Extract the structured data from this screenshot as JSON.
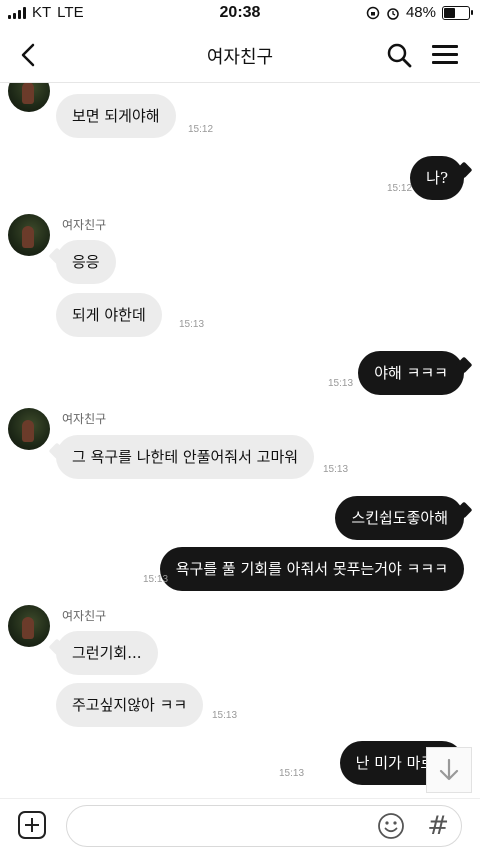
{
  "status_bar": {
    "carrier": "KT",
    "network": "LTE",
    "time": "20:38",
    "battery": "48%",
    "battery_level": 0.48
  },
  "header": {
    "title": "여자친구"
  },
  "messages": [
    {
      "text": "보면 되게야해",
      "time": "15:12",
      "direction": "in"
    },
    {
      "text": "나?",
      "time": "15:12",
      "direction": "out"
    },
    {
      "sender": "여자친구",
      "text": "응응",
      "direction": "in"
    },
    {
      "text": "되게 야한데",
      "time": "15:13",
      "direction": "in"
    },
    {
      "text": "야해 ㅋㅋㅋ",
      "time": "15:13",
      "direction": "out"
    },
    {
      "sender": "여자친구",
      "text": "그 욕구를 나한테 안풀어줘서 고마워",
      "time": "15:13",
      "direction": "in"
    },
    {
      "text": "스킨쉽도좋아해",
      "direction": "out"
    },
    {
      "text": "욕구를 풀 기회를 아줘서 못푸는거야 ㅋㅋㅋ",
      "time": "15:13",
      "direction": "out"
    },
    {
      "sender": "여자친구",
      "text": "그런기회...",
      "direction": "in"
    },
    {
      "text": "주고싶지않아 ㅋㅋ",
      "time": "15:13",
      "direction": "in"
    },
    {
      "text": "난 미가 마르겠",
      "time": "15:13",
      "direction": "out"
    }
  ],
  "input": {
    "placeholder": "",
    "hash_symbol": "#"
  },
  "colors": {
    "bubble_in": "#ececec",
    "bubble_out": "#161616",
    "background": "#ffffff"
  },
  "icons": [
    "back-arrow-icon",
    "search-icon",
    "menu-icon",
    "plus-icon",
    "emoji-icon",
    "scroll-down-icon",
    "alarm-icon",
    "rotation-lock-icon"
  ]
}
